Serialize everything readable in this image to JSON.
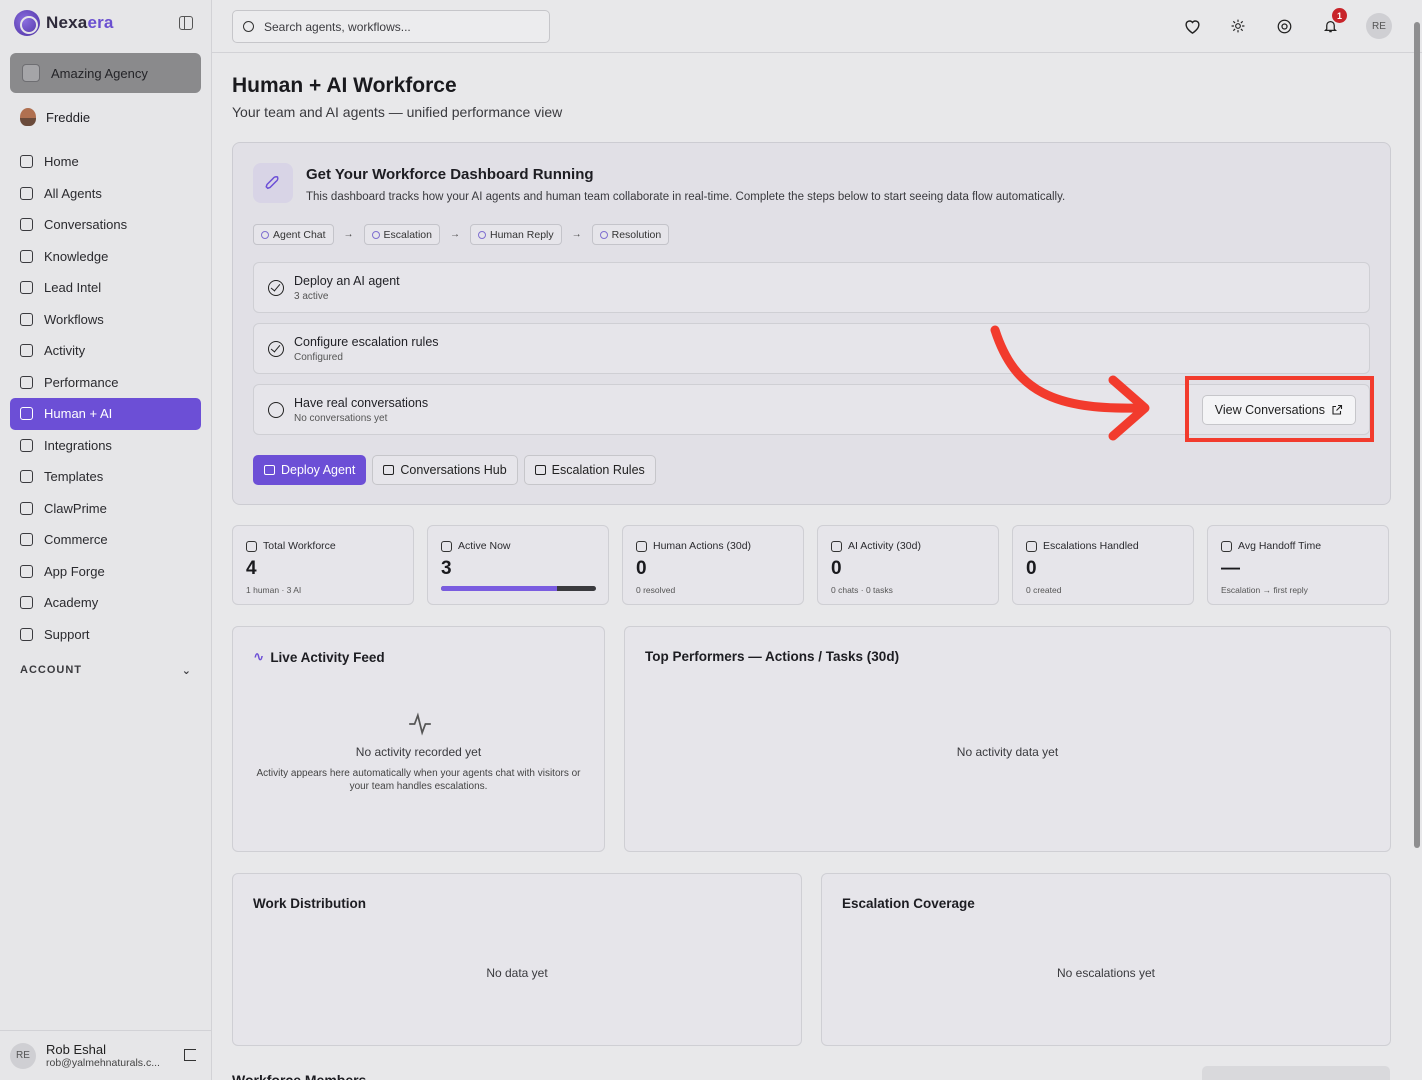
{
  "brand": {
    "name_a": "Nexa",
    "name_b": "era"
  },
  "agency": "Amazing Agency",
  "user": "Freddie",
  "nav": [
    {
      "label": "Home"
    },
    {
      "label": "All Agents"
    },
    {
      "label": "Conversations"
    },
    {
      "label": "Knowledge"
    },
    {
      "label": "Lead Intel"
    },
    {
      "label": "Workflows"
    },
    {
      "label": "Activity"
    },
    {
      "label": "Performance"
    },
    {
      "label": "Human + AI",
      "active": true
    },
    {
      "label": "Integrations"
    },
    {
      "label": "Templates"
    },
    {
      "label": "ClawPrime"
    },
    {
      "label": "Commerce"
    },
    {
      "label": "App Forge"
    },
    {
      "label": "Academy"
    },
    {
      "label": "Support"
    }
  ],
  "account_label": "ACCOUNT",
  "profile": {
    "initials": "RE",
    "name": "Rob Eshal",
    "email": "rob@yalmehnaturals.c..."
  },
  "search": {
    "placeholder": "Search agents, workflows..."
  },
  "notifications": {
    "count": "1"
  },
  "top_avatar": "RE",
  "page": {
    "title": "Human + AI Workforce",
    "subtitle": "Your team and AI agents — unified performance view"
  },
  "setup": {
    "heading": "Get Your Workforce Dashboard Running",
    "description": "This dashboard tracks how your AI agents and human team collaborate in real-time. Complete the steps below to start seeing data flow automatically.",
    "flow": [
      "Agent Chat",
      "Escalation",
      "Human Reply",
      "Resolution"
    ],
    "steps": [
      {
        "title": "Deploy an AI agent",
        "status": "3 active",
        "done": true
      },
      {
        "title": "Configure escalation rules",
        "status": "Configured",
        "done": true
      },
      {
        "title": "Have real conversations",
        "status": "No conversations yet",
        "done": false,
        "action": "View Conversations"
      }
    ],
    "buttons": [
      "Deploy Agent",
      "Conversations Hub",
      "Escalation Rules"
    ]
  },
  "stats": [
    {
      "label": "Total Workforce",
      "value": "4",
      "sub": "1 human · 3 AI"
    },
    {
      "label": "Active Now",
      "value": "3",
      "progress": 0.75
    },
    {
      "label": "Human Actions (30d)",
      "value": "0",
      "sub": "0 resolved"
    },
    {
      "label": "AI Activity (30d)",
      "value": "0",
      "sub": "0 chats · 0 tasks"
    },
    {
      "label": "Escalations Handled",
      "value": "0",
      "sub": "0 created"
    },
    {
      "label": "Avg Handoff Time",
      "value": "—",
      "sub": "Escalation → first reply"
    }
  ],
  "panels": {
    "feed": {
      "title": "Live Activity Feed",
      "empty": "No activity recorded yet",
      "hint": "Activity appears here automatically when your agents chat with visitors or your team handles escalations."
    },
    "top": {
      "title": "Top Performers — Actions / Tasks (30d)",
      "empty": "No activity data yet"
    },
    "dist": {
      "title": "Work Distribution",
      "empty": "No data yet"
    },
    "esc": {
      "title": "Escalation Coverage",
      "empty": "No escalations yet"
    }
  },
  "members_title": "Workforce Members",
  "colors": {
    "accent": "#6c4fd6",
    "highlight": "#f23b2d",
    "badge": "#c8242a"
  }
}
